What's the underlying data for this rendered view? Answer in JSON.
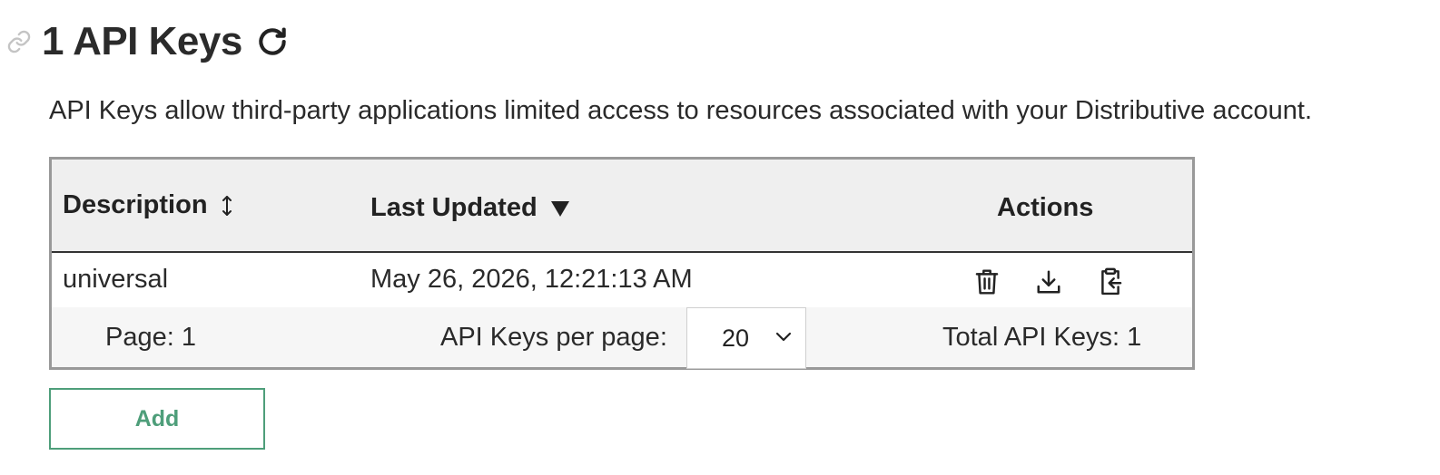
{
  "header": {
    "count": "1",
    "title": "1 API Keys",
    "icons": {
      "anchor": "link-icon",
      "refresh": "refresh-icon"
    }
  },
  "description": "API Keys allow third-party applications limited access to resources associated with your Distributive account.",
  "table": {
    "columns": [
      {
        "label": "Description",
        "sort_state": "unsorted",
        "sort_icon": "sort-both-icon"
      },
      {
        "label": "Last Updated",
        "sort_state": "descending",
        "sort_icon": "sort-down-icon"
      },
      {
        "label": "Actions"
      }
    ],
    "rows": [
      {
        "description": "universal",
        "last_updated": "May 26, 2026, 12:21:13 AM",
        "actions": [
          "trash-icon",
          "download-icon",
          "clipboard-copy-icon"
        ]
      }
    ],
    "footer": {
      "page_label": "Page: 1",
      "per_page_label": "API Keys per page:",
      "per_page_value": "20",
      "total_label": "Total API Keys: 1"
    }
  },
  "add_button_label": "Add",
  "colors": {
    "accent": "#4e9e7a",
    "header_bg": "#efefef",
    "footer_bg": "#f6f6f6",
    "border": "#999999"
  }
}
